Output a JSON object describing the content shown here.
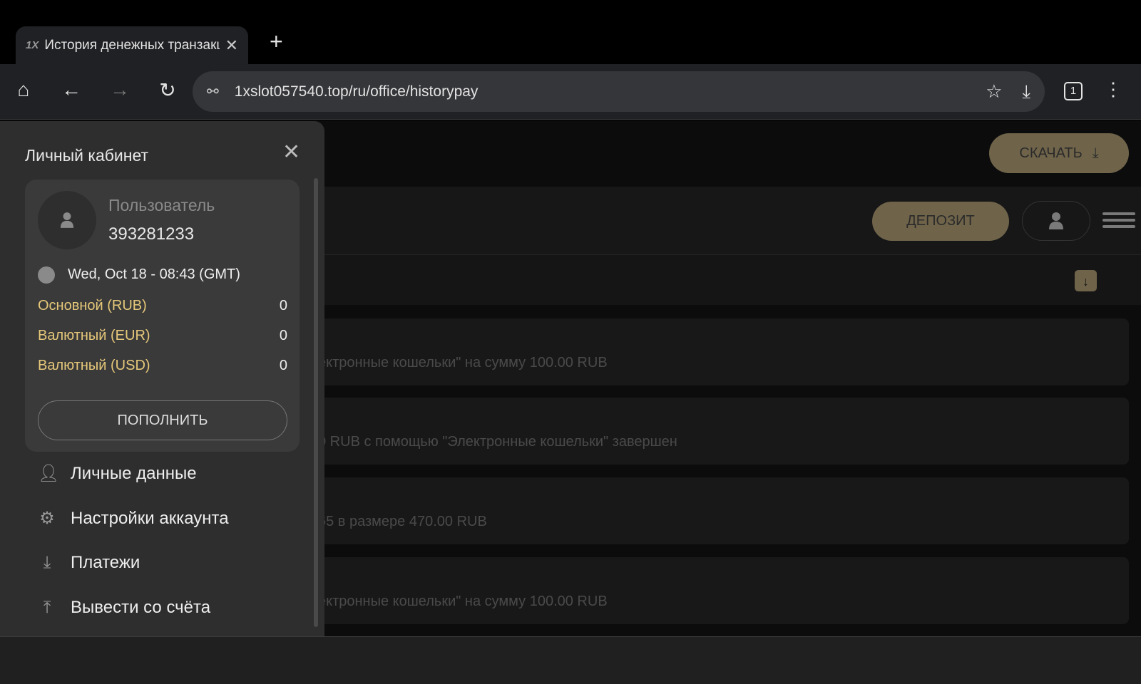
{
  "browser": {
    "tab_title": "История денежных транзакций",
    "tab_logo": "1X",
    "url": "1xslot057540.top/ru/office/historypay",
    "tab_count": "1"
  },
  "header": {
    "download_label": "СКАЧАТЬ",
    "deposit_label": "ДЕПОЗИТ"
  },
  "history": [
    "ектронные кошельки\" на сумму 100.00 RUB",
    "0 RUB с помощью \"Электронные кошельки\" завершен",
    "65 в размере 470.00 RUB",
    "ектронные кошельки\" на сумму 100.00 RUB"
  ],
  "panel": {
    "title": "Личный кабинет",
    "user_label": "Пользователь",
    "user_id": "393281233",
    "datetime": "Wed, Oct 18 - 08:43 (GMT)",
    "balances": [
      {
        "name": "Основной (RUB)",
        "value": "0"
      },
      {
        "name": "Валютный (EUR)",
        "value": "0"
      },
      {
        "name": "Валютный (USD)",
        "value": "0"
      }
    ],
    "topup_label": "ПОПОЛНИТЬ",
    "menu": [
      {
        "label": "Личные данные",
        "icon": "user-icon"
      },
      {
        "label": "Настройки аккаунта",
        "icon": "gear-icon"
      },
      {
        "label": "Платежи",
        "icon": "download-arrow-icon"
      },
      {
        "label": "Вывести со счёта",
        "icon": "upload-arrow-icon"
      }
    ]
  },
  "colors": {
    "accent": "#6f644a",
    "balance": "#e6c87a"
  }
}
